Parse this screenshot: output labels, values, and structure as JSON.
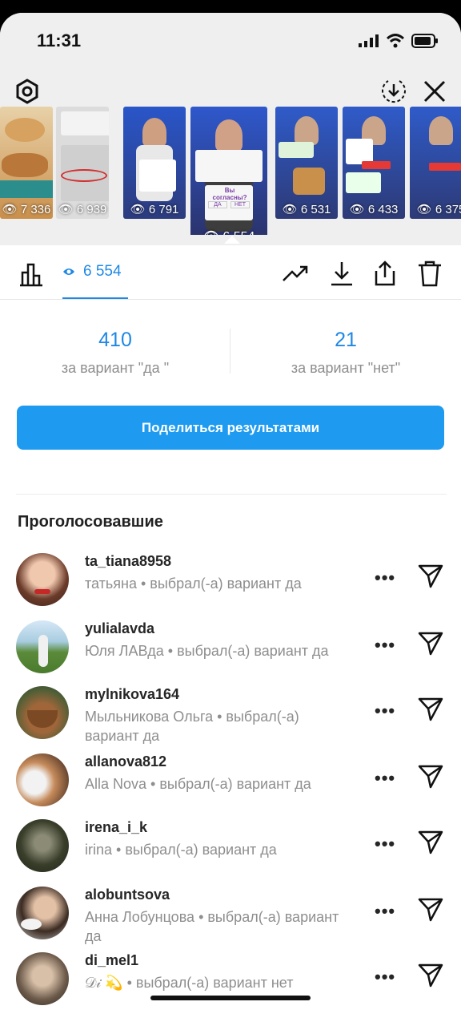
{
  "status_bar": {
    "time": "11:31"
  },
  "top_bar": {
    "settings_icon": "gear-icon",
    "save_icon": "download-circle-icon",
    "close_icon": "close-icon"
  },
  "thumbnails": [
    {
      "views": "7 336"
    },
    {
      "views": "6 939"
    },
    {
      "views": "6 791"
    },
    {
      "views": "6 554",
      "selected": true,
      "sticker_question": "Вы согласны?",
      "option_yes": "ДА",
      "option_no": "НЕТ"
    },
    {
      "views": "6 531"
    },
    {
      "views": "6 433"
    },
    {
      "views": "6 375"
    }
  ],
  "toolbar": {
    "views": "6 554",
    "icons": [
      "bar-chart-icon",
      "eye-icon",
      "trending-icon",
      "download-icon",
      "share-icon",
      "trash-icon"
    ]
  },
  "results": {
    "yes": {
      "count": "410",
      "label": "за вариант \"да \""
    },
    "no": {
      "count": "21",
      "label": "за вариант \"нет\""
    }
  },
  "share_button": "Поделиться результатами",
  "voters_title": "Проголосовавшие",
  "voters": [
    {
      "username": "ta_tiana8958",
      "subtitle": "татьяна • выбрал(-а) вариант да"
    },
    {
      "username": "yulialavda",
      "subtitle": "Юля ЛАВда • выбрал(-а) вариант да"
    },
    {
      "username": "mylnikova164",
      "subtitle": "Мыльникова Ольга • выбрал(-а) вариант да"
    },
    {
      "username": "allanova812",
      "subtitle": "Alla Nova • выбрал(-а) вариант да"
    },
    {
      "username": "irena_i_k",
      "subtitle": "irina • выбрал(-а) вариант да"
    },
    {
      "username": "alobuntsova",
      "subtitle": "Анна Лобунцова • выбрал(-а) вариант да"
    },
    {
      "username": "di_mel1",
      "subtitle": "𝒟𝒾 💫 • выбрал(-а) вариант нет"
    }
  ],
  "colors": {
    "accent": "#1e88e5",
    "button": "#1e9bf0",
    "muted": "#8e8e8e"
  }
}
